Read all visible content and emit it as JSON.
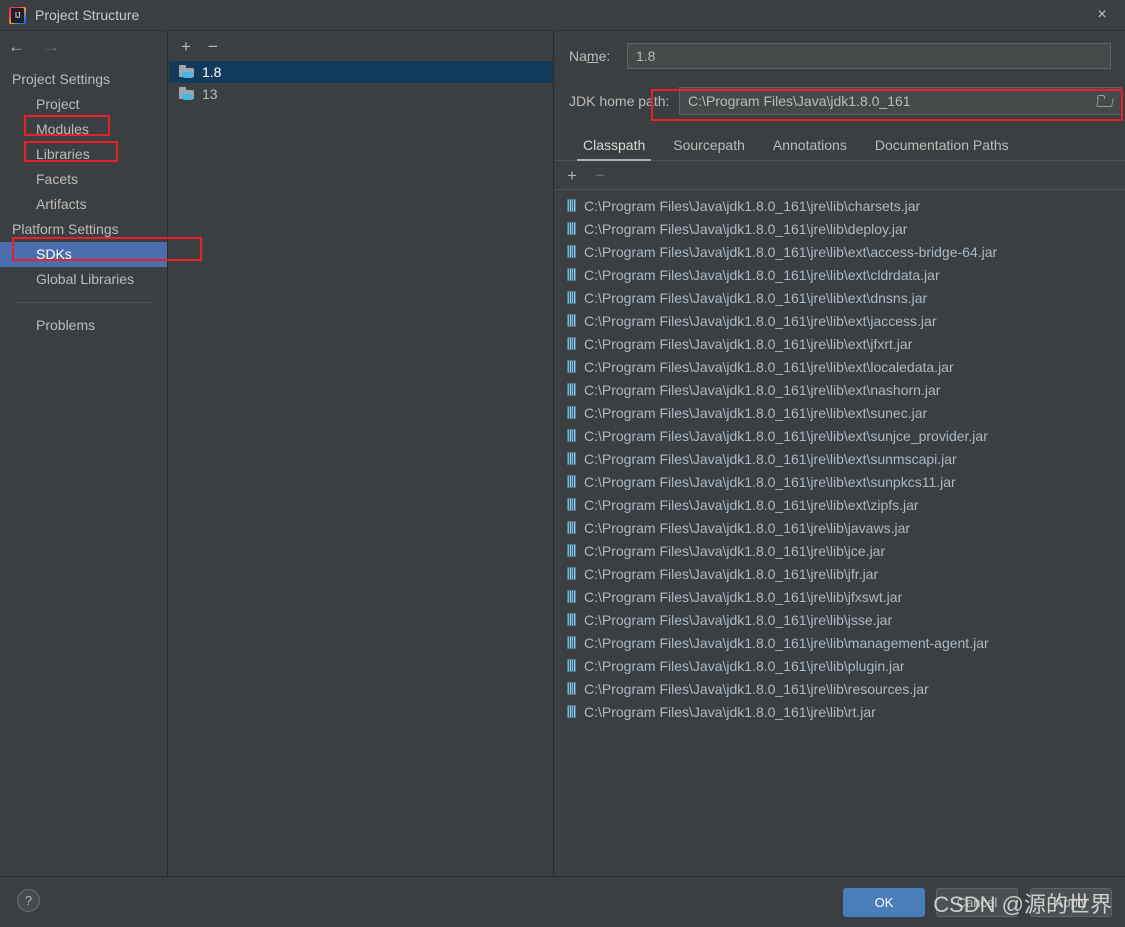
{
  "window": {
    "title": "Project Structure",
    "logo_icon": "intellij-idea-logo",
    "letters": "IJ",
    "close_icon": "×"
  },
  "nav": {
    "back_icon": "←",
    "forward_icon": "→"
  },
  "sidebar": {
    "groups": [
      {
        "label": "Project Settings"
      },
      {
        "label": "Platform Settings"
      }
    ],
    "items": [
      {
        "label": "Project",
        "selected": false,
        "annotated": false
      },
      {
        "label": "Modules",
        "selected": false,
        "annotated": true
      },
      {
        "label": "Libraries",
        "selected": false,
        "annotated": true
      },
      {
        "label": "Facets",
        "selected": false,
        "annotated": false
      },
      {
        "label": "Artifacts",
        "selected": false,
        "annotated": false
      },
      {
        "label": "SDKs",
        "selected": true,
        "annotated": true
      },
      {
        "label": "Global Libraries",
        "selected": false,
        "annotated": false
      },
      {
        "label": "Problems",
        "selected": false,
        "annotated": false
      }
    ]
  },
  "sdk_panel": {
    "add_icon": "+",
    "remove_icon": "−",
    "items": [
      {
        "label": "1.8",
        "selected": true,
        "icon": "java-sdk-folder-icon"
      },
      {
        "label": "13",
        "selected": false,
        "icon": "java-sdk-folder-icon"
      }
    ]
  },
  "detail": {
    "name_label": "Name:",
    "name_label_pre": "Na",
    "name_label_mnemonic": "m",
    "name_label_post": "e:",
    "name_value": "1.8",
    "jdk_label": "JDK home path:",
    "jdk_value": "C:\\Program Files\\Java\\jdk1.8.0_161",
    "browse_icon": "folder-browse-icon",
    "tabs": [
      {
        "label": "Classpath",
        "active": true
      },
      {
        "label": "Sourcepath",
        "active": false
      },
      {
        "label": "Annotations",
        "active": false
      },
      {
        "label": "Documentation Paths",
        "active": false
      }
    ],
    "classpath_toolbar": {
      "add_icon": "+",
      "remove_icon": "−"
    },
    "classpath_entries": [
      "C:\\Program Files\\Java\\jdk1.8.0_161\\jre\\lib\\charsets.jar",
      "C:\\Program Files\\Java\\jdk1.8.0_161\\jre\\lib\\deploy.jar",
      "C:\\Program Files\\Java\\jdk1.8.0_161\\jre\\lib\\ext\\access-bridge-64.jar",
      "C:\\Program Files\\Java\\jdk1.8.0_161\\jre\\lib\\ext\\cldrdata.jar",
      "C:\\Program Files\\Java\\jdk1.8.0_161\\jre\\lib\\ext\\dnsns.jar",
      "C:\\Program Files\\Java\\jdk1.8.0_161\\jre\\lib\\ext\\jaccess.jar",
      "C:\\Program Files\\Java\\jdk1.8.0_161\\jre\\lib\\ext\\jfxrt.jar",
      "C:\\Program Files\\Java\\jdk1.8.0_161\\jre\\lib\\ext\\localedata.jar",
      "C:\\Program Files\\Java\\jdk1.8.0_161\\jre\\lib\\ext\\nashorn.jar",
      "C:\\Program Files\\Java\\jdk1.8.0_161\\jre\\lib\\ext\\sunec.jar",
      "C:\\Program Files\\Java\\jdk1.8.0_161\\jre\\lib\\ext\\sunjce_provider.jar",
      "C:\\Program Files\\Java\\jdk1.8.0_161\\jre\\lib\\ext\\sunmscapi.jar",
      "C:\\Program Files\\Java\\jdk1.8.0_161\\jre\\lib\\ext\\sunpkcs11.jar",
      "C:\\Program Files\\Java\\jdk1.8.0_161\\jre\\lib\\ext\\zipfs.jar",
      "C:\\Program Files\\Java\\jdk1.8.0_161\\jre\\lib\\javaws.jar",
      "C:\\Program Files\\Java\\jdk1.8.0_161\\jre\\lib\\jce.jar",
      "C:\\Program Files\\Java\\jdk1.8.0_161\\jre\\lib\\jfr.jar",
      "C:\\Program Files\\Java\\jdk1.8.0_161\\jre\\lib\\jfxswt.jar",
      "C:\\Program Files\\Java\\jdk1.8.0_161\\jre\\lib\\jsse.jar",
      "C:\\Program Files\\Java\\jdk1.8.0_161\\jre\\lib\\management-agent.jar",
      "C:\\Program Files\\Java\\jdk1.8.0_161\\jre\\lib\\plugin.jar",
      "C:\\Program Files\\Java\\jdk1.8.0_161\\jre\\lib\\resources.jar",
      "C:\\Program Files\\Java\\jdk1.8.0_161\\jre\\lib\\rt.jar"
    ]
  },
  "footer": {
    "help_label": "?",
    "ok_label": "OK",
    "cancel_label": "Cancel",
    "apply_label": "Apply"
  },
  "watermark": {
    "text": "CSDN @源的世界"
  },
  "colors": {
    "accent_blue": "#4b6eaf",
    "ok_button": "#4a7ebb",
    "selection_dark": "#113a5c",
    "annotation_red": "#e8202a",
    "panel_bg": "#3c3f41",
    "jar_text": "#aab9c5"
  }
}
